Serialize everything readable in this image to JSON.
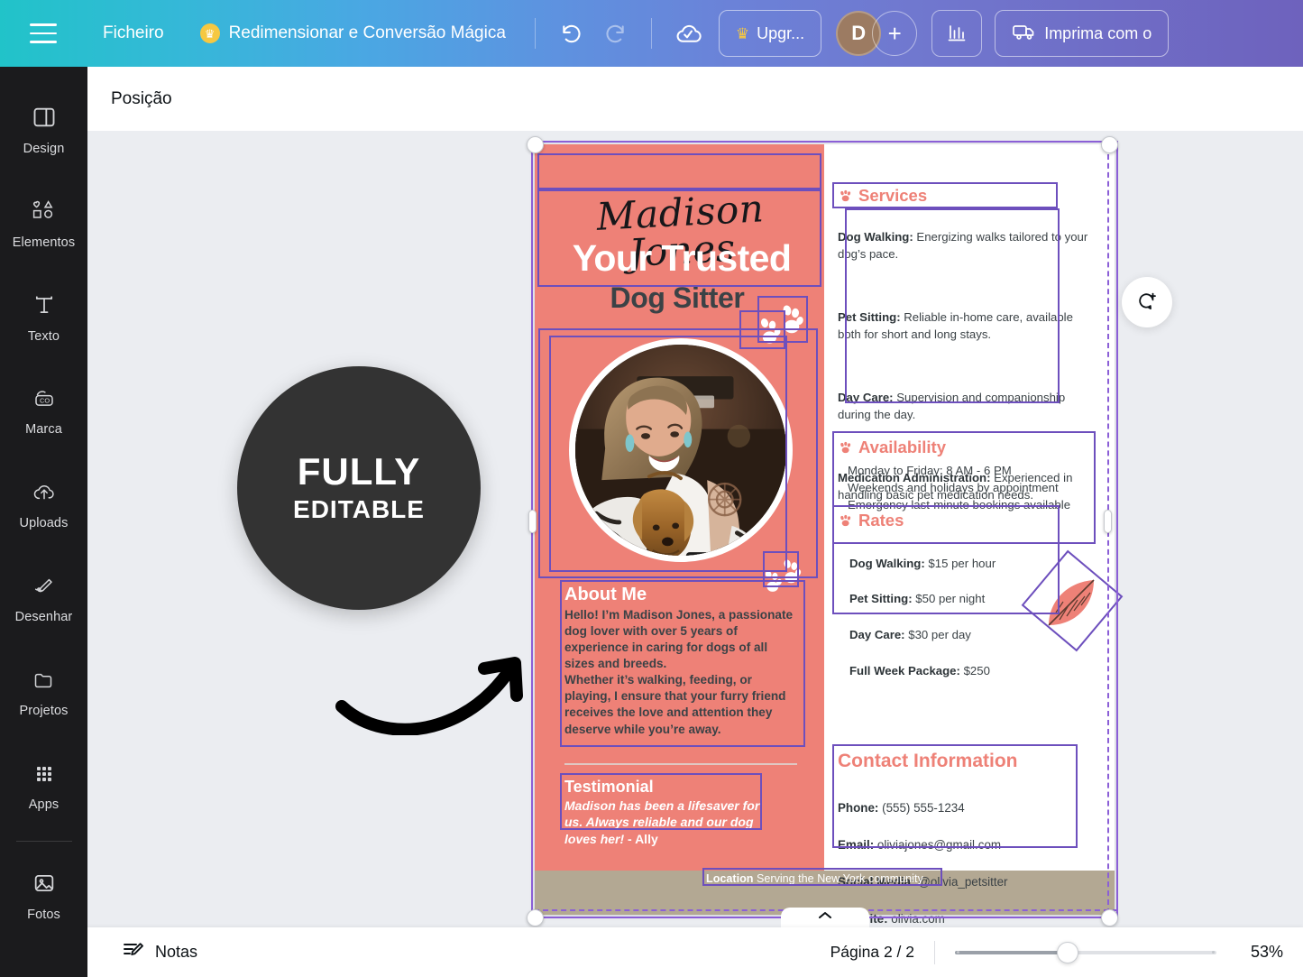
{
  "topbar": {
    "hamburger_icon": "hamburger-menu-icon",
    "file_label": "Ficheiro",
    "magic_label": "Redimensionar e Conversão Mágica",
    "crown_glyph": "♛",
    "undo_icon": "undo-icon",
    "redo_icon": "redo-icon",
    "cloud_saved_icon": "cloud-saved-icon",
    "upgrade_label": "Upgr...",
    "avatar_initial": "D",
    "add_people_glyph": "+",
    "stats_icon": "stats-bar-icon",
    "print_label": "Imprima com o",
    "print_icon": "delivery-truck-icon"
  },
  "sidebar": {
    "items": [
      {
        "label": "Design",
        "icon": "design-layout-icon"
      },
      {
        "label": "Elementos",
        "icon": "shapes-elements-icon"
      },
      {
        "label": "Texto",
        "icon": "text-t-icon"
      },
      {
        "label": "Marca",
        "icon": "brand-kit-icon"
      },
      {
        "label": "Uploads",
        "icon": "upload-cloud-icon"
      },
      {
        "label": "Desenhar",
        "icon": "draw-pen-icon"
      },
      {
        "label": "Projetos",
        "icon": "folder-projects-icon"
      },
      {
        "label": "Apps",
        "icon": "apps-grid-icon"
      },
      {
        "label": "Fotos",
        "icon": "photos-image-icon"
      }
    ]
  },
  "subbar": {
    "position_label": "Posição"
  },
  "canvas": {
    "comment_icon": "add-comment-icon",
    "badge": {
      "line1": "FULLY",
      "line2": "EDITABLE"
    },
    "arrow_icon": "curved-arrow-icon"
  },
  "poster": {
    "colors": {
      "pink": "#ee8177",
      "dark_text": "#3b4246",
      "footer_tan": "#b3a893",
      "selection_purple": "#6d4fbd"
    },
    "script_name": "Madison Jones",
    "headline_1": "Your Trusted",
    "headline_2": "Dog Sitter",
    "about": {
      "title": "About Me",
      "body": "Hello! I’m Madison Jones, a passionate dog lover with over 5 years of experience in caring for dogs of all sizes and breeds.\nWhether it’s walking, feeding, or playing, I ensure that your furry friend receives the love and attention they deserve while you’re away."
    },
    "testimonial": {
      "title": "Testimonial",
      "quote": "Madison has been a lifesaver for us. Always reliable and our dog loves her!",
      "author": " - Ally"
    },
    "services": {
      "title": "Services",
      "items": [
        {
          "name": "Dog Walking:",
          "desc": " Energizing walks tailored to your dog’s pace."
        },
        {
          "name": "Pet Sitting:",
          "desc": " Reliable in-home care, available both for short and long stays."
        },
        {
          "name": "Day Care:",
          "desc": " Supervision and companionship during the day."
        },
        {
          "name": "Medication Administration:",
          "desc": " Experienced in handling basic pet medication needs."
        }
      ]
    },
    "availability": {
      "title": "Availability",
      "body": "Monday to Friday: 8 AM - 6 PM\nWeekends and holidays by appointment\nEmergency last-minute bookings available"
    },
    "rates": {
      "title": "Rates",
      "items": [
        {
          "name": "Dog Walking:",
          "value": " $15 per hour"
        },
        {
          "name": "Pet Sitting:",
          "value": " $50 per night"
        },
        {
          "name": "Day Care:",
          "value": " $30 per day"
        },
        {
          "name": "Full Week Package:",
          "value": " $250"
        }
      ]
    },
    "contact": {
      "title": "Contact Information",
      "items": [
        {
          "name": "Phone:",
          "value": " (555) 555-1234"
        },
        {
          "name": "Email:",
          "value": " oliviajones@gmail.com"
        },
        {
          "name": "Social Media:",
          "value": " @olivia_petsitter"
        },
        {
          "name": "Website:",
          "value": " olivia.com"
        }
      ]
    },
    "footer": {
      "label": "Location",
      "text": " Serving the New York community"
    },
    "paw_icon": "paw-print-icon",
    "leaf_icon": "leaf-decoration-icon"
  },
  "bottombar": {
    "notes_label": "Notas",
    "notes_icon": "notes-pencil-icon",
    "page_count": "Página 2 / 2",
    "zoom_percent": "53%",
    "expand_icon": "chevron-up-icon"
  }
}
